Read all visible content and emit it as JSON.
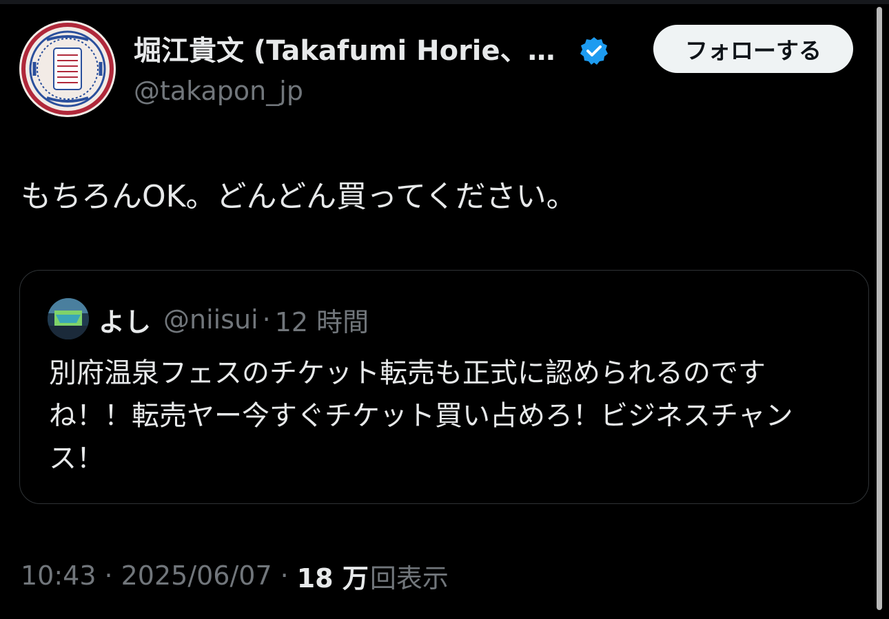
{
  "author": {
    "display_name": "堀江貴文 (Takafumi Horie、…",
    "handle": "@takapon_jp",
    "verified_icon": "verified-badge-icon",
    "avatar_icon": "seal-logo-avatar"
  },
  "follow_button": {
    "label": "フォローする"
  },
  "tweet": {
    "text": "もちろんOK。どんどん買ってください。"
  },
  "quote": {
    "avatar_icon": "landscape-avatar",
    "name": "よし",
    "handle": "@niisui",
    "dot": "·",
    "time": "12 時間",
    "text": "別府温泉フェスのチケット転売も正式に認められるのですね！！転売ヤー今すぐチケット買い占めろ！ビジネスチャンス！"
  },
  "footer": {
    "time": "10:43",
    "sep1": "·",
    "date": "2025/06/07",
    "sep2": "·",
    "views_count": "18 万",
    "views_label": "回表示"
  },
  "colors": {
    "background": "#000000",
    "text": "#e7e9ea",
    "muted": "#71767b",
    "border": "#2f3336",
    "verified": "#1d9bf0",
    "button_bg": "#eff3f4"
  }
}
